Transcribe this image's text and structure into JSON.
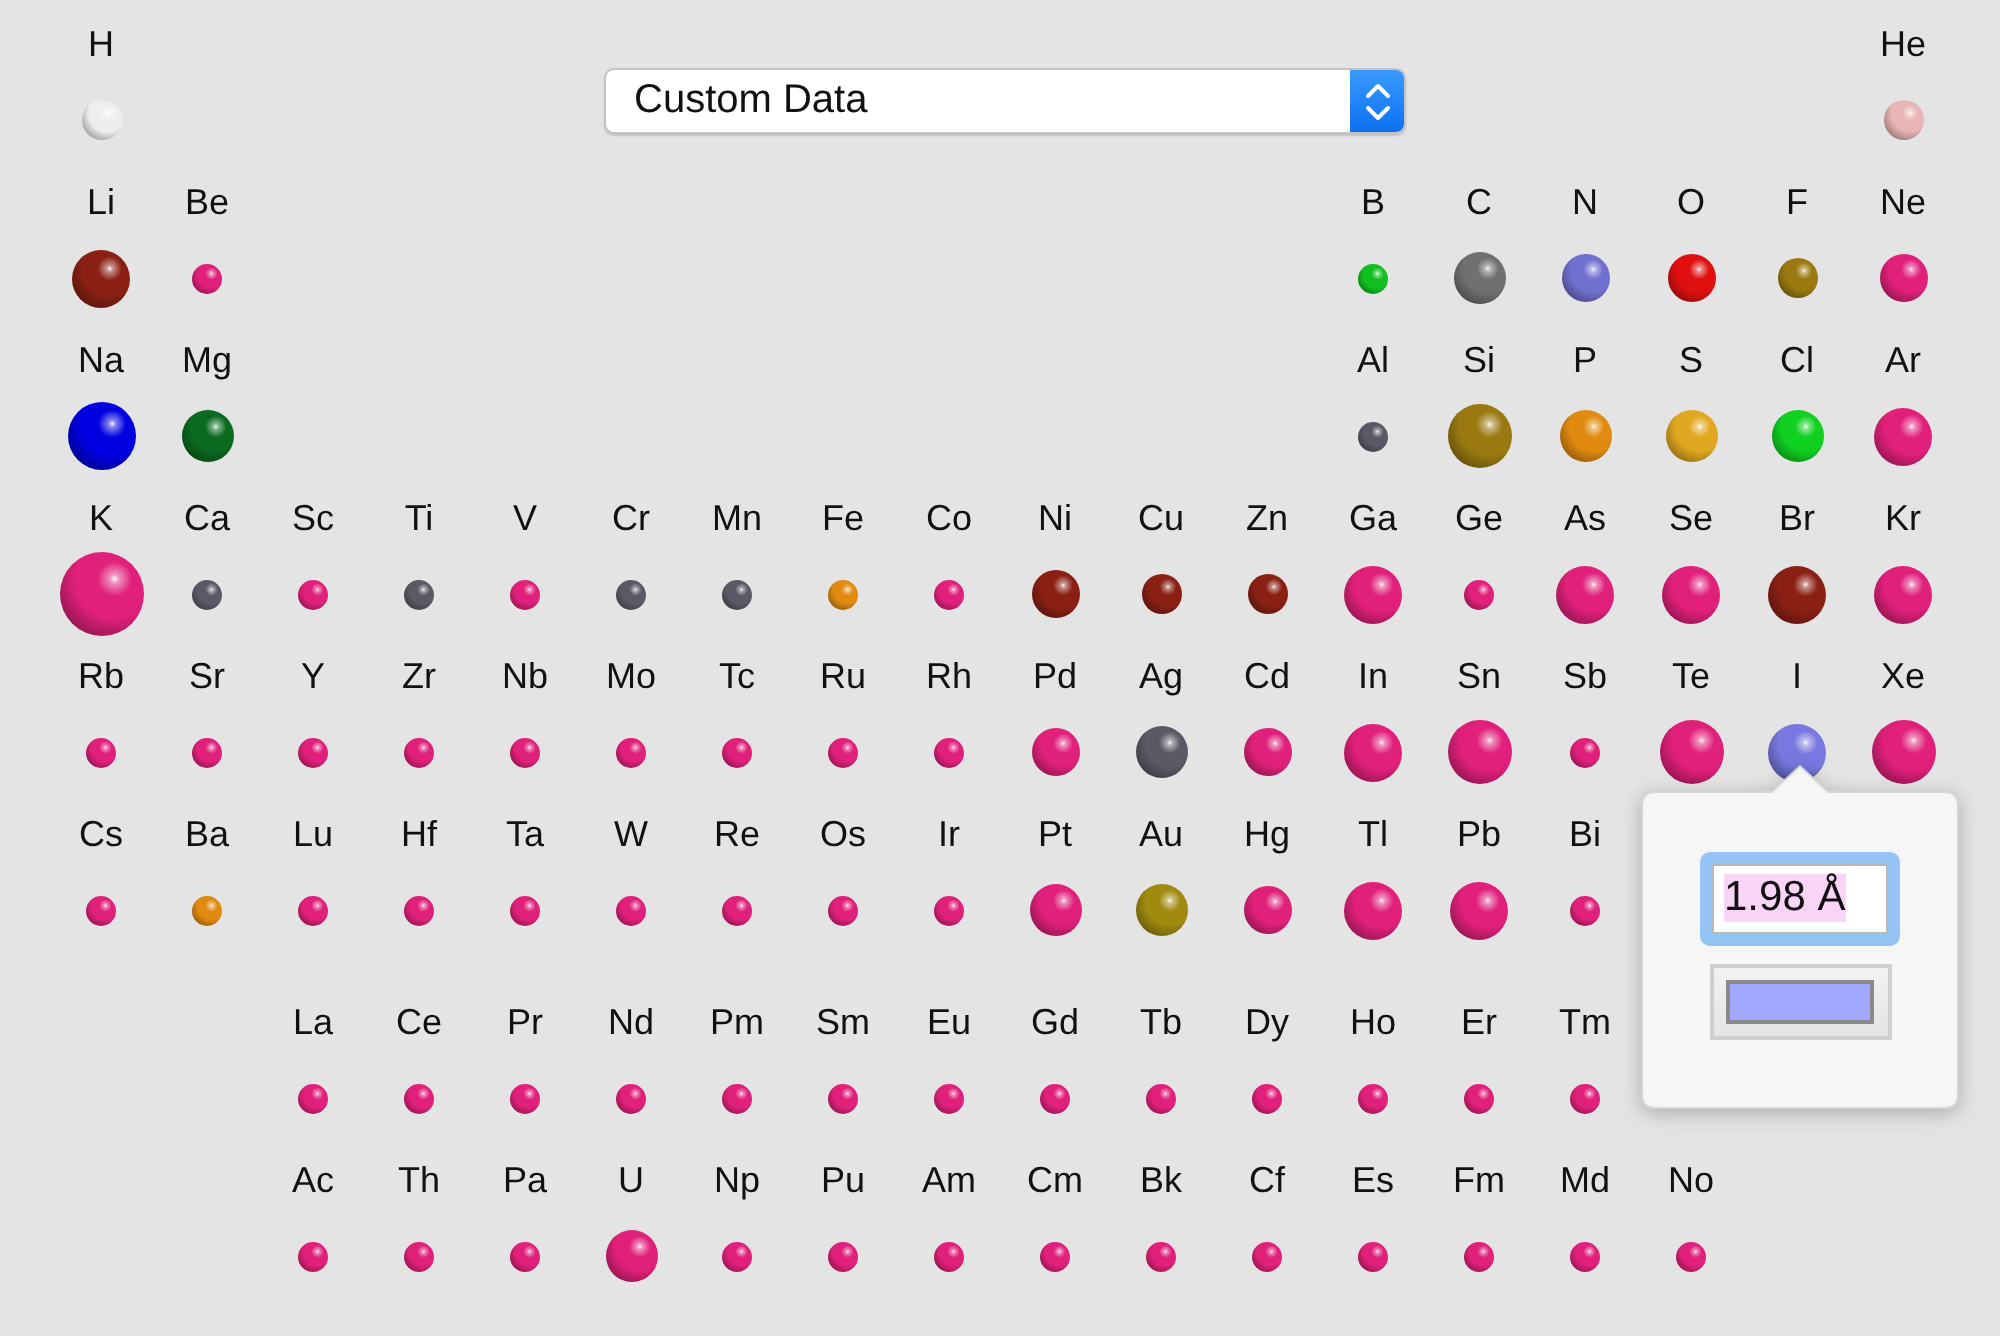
{
  "data_source_popup": {
    "value": "Custom Data"
  },
  "periods": [
    {
      "kind": "main",
      "left": [
        {
          "symbol": "H",
          "kind": "small",
          "color": "#eeeeee",
          "selected": false
        }
      ],
      "right": [
        {
          "symbol": "He",
          "kind": "small",
          "color": "#e8b4b4",
          "selected": false
        }
      ]
    },
    {
      "kind": "main",
      "left": [
        {
          "symbol": "Li",
          "kind": "larger",
          "color": "#8a2014",
          "selected": false
        },
        {
          "symbol": "Be",
          "kind": "tiny",
          "color": "#e0207a",
          "selected": false
        }
      ],
      "right": [
        {
          "symbol": "B",
          "kind": "tiny",
          "color": "#10c020",
          "selected": false
        },
        {
          "symbol": "C",
          "kind": "large",
          "color": "#707070",
          "selected": false
        },
        {
          "symbol": "N",
          "kind": "medium",
          "color": "#7070d0",
          "selected": false
        },
        {
          "symbol": "O",
          "kind": "medium",
          "color": "#e01010",
          "selected": false
        },
        {
          "symbol": "F",
          "kind": "small",
          "color": "#9a7a10",
          "selected": false
        },
        {
          "symbol": "Ne",
          "kind": "medium",
          "color": "#e0207a",
          "selected": false
        }
      ]
    },
    {
      "kind": "main",
      "left": [
        {
          "symbol": "Na",
          "kind": "bigger",
          "color": "#0000e0",
          "selected": false
        },
        {
          "symbol": "Mg",
          "kind": "large",
          "color": "#0a6a20",
          "selected": false
        }
      ],
      "right": [
        {
          "symbol": "Al",
          "kind": "tiny",
          "color": "#5a5a66",
          "selected": false
        },
        {
          "symbol": "Si",
          "kind": "big",
          "color": "#9a7a10",
          "selected": false
        },
        {
          "symbol": "P",
          "kind": "large",
          "color": "#e08a10",
          "selected": false
        },
        {
          "symbol": "S",
          "kind": "large",
          "color": "#e0a820",
          "selected": false
        },
        {
          "symbol": "Cl",
          "kind": "large",
          "color": "#10d020",
          "selected": false
        },
        {
          "symbol": "Ar",
          "kind": "larger",
          "color": "#e0207a",
          "selected": false
        }
      ]
    },
    {
      "kind": "main",
      "left": [
        {
          "symbol": "K",
          "kind": "huge",
          "color": "#e0207a",
          "selected": false
        },
        {
          "symbol": "Ca",
          "kind": "tiny",
          "color": "#5a5a66",
          "selected": false
        },
        {
          "symbol": "Sc",
          "kind": "tiny",
          "color": "#e0207a",
          "selected": false
        },
        {
          "symbol": "Ti",
          "kind": "tiny",
          "color": "#5a5a66",
          "selected": false
        },
        {
          "symbol": "V",
          "kind": "tiny",
          "color": "#e0207a",
          "selected": false
        },
        {
          "symbol": "Cr",
          "kind": "tiny",
          "color": "#5a5a66",
          "selected": false
        },
        {
          "symbol": "Mn",
          "kind": "tiny",
          "color": "#5a5a66",
          "selected": false
        },
        {
          "symbol": "Fe",
          "kind": "tiny",
          "color": "#e08a10",
          "selected": false
        },
        {
          "symbol": "Co",
          "kind": "tiny",
          "color": "#e0207a",
          "selected": false
        },
        {
          "symbol": "Ni",
          "kind": "medium",
          "color": "#8a2014",
          "selected": false
        },
        {
          "symbol": "Cu",
          "kind": "small",
          "color": "#8a2014",
          "selected": false
        },
        {
          "symbol": "Zn",
          "kind": "small",
          "color": "#8a2014",
          "selected": false
        },
        {
          "symbol": "Ga",
          "kind": "larger",
          "color": "#e0207a",
          "selected": false
        },
        {
          "symbol": "Ge",
          "kind": "tiny",
          "color": "#e0207a",
          "selected": false
        },
        {
          "symbol": "As",
          "kind": "larger",
          "color": "#e0207a",
          "selected": false
        },
        {
          "symbol": "Se",
          "kind": "larger",
          "color": "#e0207a",
          "selected": false
        },
        {
          "symbol": "Br",
          "kind": "larger",
          "color": "#8a2014",
          "selected": false
        },
        {
          "symbol": "Kr",
          "kind": "larger",
          "color": "#e0207a",
          "selected": false
        }
      ]
    },
    {
      "kind": "main",
      "left": [
        {
          "symbol": "Rb",
          "kind": "tiny",
          "color": "#e0207a",
          "selected": false
        },
        {
          "symbol": "Sr",
          "kind": "tiny",
          "color": "#e0207a",
          "selected": false
        },
        {
          "symbol": "Y",
          "kind": "tiny",
          "color": "#e0207a",
          "selected": false
        },
        {
          "symbol": "Zr",
          "kind": "tiny",
          "color": "#e0207a",
          "selected": false
        },
        {
          "symbol": "Nb",
          "kind": "tiny",
          "color": "#e0207a",
          "selected": false
        },
        {
          "symbol": "Mo",
          "kind": "tiny",
          "color": "#e0207a",
          "selected": false
        },
        {
          "symbol": "Tc",
          "kind": "tiny",
          "color": "#e0207a",
          "selected": false
        },
        {
          "symbol": "Ru",
          "kind": "tiny",
          "color": "#e0207a",
          "selected": false
        },
        {
          "symbol": "Rh",
          "kind": "tiny",
          "color": "#e0207a",
          "selected": false
        },
        {
          "symbol": "Pd",
          "kind": "medium",
          "color": "#e0207a",
          "selected": false
        },
        {
          "symbol": "Ag",
          "kind": "large",
          "color": "#5a5a66",
          "selected": false
        },
        {
          "symbol": "Cd",
          "kind": "medium",
          "color": "#e0207a",
          "selected": false
        },
        {
          "symbol": "In",
          "kind": "larger",
          "color": "#e0207a",
          "selected": false
        },
        {
          "symbol": "Sn",
          "kind": "big",
          "color": "#e0207a",
          "selected": false
        },
        {
          "symbol": "Sb",
          "kind": "tiny",
          "color": "#e0207a",
          "selected": false
        },
        {
          "symbol": "Te",
          "kind": "big",
          "color": "#e0207a",
          "selected": false
        },
        {
          "symbol": "I",
          "kind": "larger",
          "color": "#7878e0",
          "selected": true
        },
        {
          "symbol": "Xe",
          "kind": "big",
          "color": "#e0207a",
          "selected": false
        }
      ]
    },
    {
      "kind": "main",
      "left": [
        {
          "symbol": "Cs",
          "kind": "tiny",
          "color": "#e0207a",
          "selected": false
        },
        {
          "symbol": "Ba",
          "kind": "tiny",
          "color": "#e08a10",
          "selected": false
        },
        {
          "symbol": "Lu",
          "kind": "tiny",
          "color": "#e0207a",
          "selected": false
        },
        {
          "symbol": "Hf",
          "kind": "tiny",
          "color": "#e0207a",
          "selected": false
        },
        {
          "symbol": "Ta",
          "kind": "tiny",
          "color": "#e0207a",
          "selected": false
        },
        {
          "symbol": "W",
          "kind": "tiny",
          "color": "#e0207a",
          "selected": false
        },
        {
          "symbol": "Re",
          "kind": "tiny",
          "color": "#e0207a",
          "selected": false
        },
        {
          "symbol": "Os",
          "kind": "tiny",
          "color": "#e0207a",
          "selected": false
        },
        {
          "symbol": "Ir",
          "kind": "tiny",
          "color": "#e0207a",
          "selected": false
        },
        {
          "symbol": "Pt",
          "kind": "large",
          "color": "#e0207a",
          "selected": false
        },
        {
          "symbol": "Au",
          "kind": "large",
          "color": "#a08a10",
          "selected": false
        },
        {
          "symbol": "Hg",
          "kind": "medium",
          "color": "#e0207a",
          "selected": false
        },
        {
          "symbol": "Tl",
          "kind": "larger",
          "color": "#e0207a",
          "selected": false
        },
        {
          "symbol": "Pb",
          "kind": "larger",
          "color": "#e0207a",
          "selected": false
        },
        {
          "symbol": "Bi",
          "kind": "tiny",
          "color": "#e0207a",
          "selected": false
        }
      ]
    },
    {
      "kind": "f-block",
      "left": [
        {
          "symbol": "La",
          "kind": "tiny",
          "color": "#e0207a",
          "selected": false
        },
        {
          "symbol": "Ce",
          "kind": "tiny",
          "color": "#e0207a",
          "selected": false
        },
        {
          "symbol": "Pr",
          "kind": "tiny",
          "color": "#e0207a",
          "selected": false
        },
        {
          "symbol": "Nd",
          "kind": "tiny",
          "color": "#e0207a",
          "selected": false
        },
        {
          "symbol": "Pm",
          "kind": "tiny",
          "color": "#e0207a",
          "selected": false
        },
        {
          "symbol": "Sm",
          "kind": "tiny",
          "color": "#e0207a",
          "selected": false
        },
        {
          "symbol": "Eu",
          "kind": "tiny",
          "color": "#e0207a",
          "selected": false
        },
        {
          "symbol": "Gd",
          "kind": "tiny",
          "color": "#e0207a",
          "selected": false
        },
        {
          "symbol": "Tb",
          "kind": "tiny",
          "color": "#e0207a",
          "selected": false
        },
        {
          "symbol": "Dy",
          "kind": "tiny",
          "color": "#e0207a",
          "selected": false
        },
        {
          "symbol": "Ho",
          "kind": "tiny",
          "color": "#e0207a",
          "selected": false
        },
        {
          "symbol": "Er",
          "kind": "tiny",
          "color": "#e0207a",
          "selected": false
        },
        {
          "symbol": "Tm",
          "kind": "tiny",
          "color": "#e0207a",
          "selected": false
        }
      ]
    },
    {
      "kind": "f-block",
      "left": [
        {
          "symbol": "Ac",
          "kind": "tiny",
          "color": "#e0207a",
          "selected": false
        },
        {
          "symbol": "Th",
          "kind": "tiny",
          "color": "#e0207a",
          "selected": false
        },
        {
          "symbol": "Pa",
          "kind": "tiny",
          "color": "#e0207a",
          "selected": false
        },
        {
          "symbol": "U",
          "kind": "large",
          "color": "#e0207a",
          "selected": false
        },
        {
          "symbol": "Np",
          "kind": "tiny",
          "color": "#e0207a",
          "selected": false
        },
        {
          "symbol": "Pu",
          "kind": "tiny",
          "color": "#e0207a",
          "selected": false
        },
        {
          "symbol": "Am",
          "kind": "tiny",
          "color": "#e0207a",
          "selected": false
        },
        {
          "symbol": "Cm",
          "kind": "tiny",
          "color": "#e0207a",
          "selected": false
        },
        {
          "symbol": "Bk",
          "kind": "tiny",
          "color": "#e0207a",
          "selected": false
        },
        {
          "symbol": "Cf",
          "kind": "tiny",
          "color": "#e0207a",
          "selected": false
        },
        {
          "symbol": "Es",
          "kind": "tiny",
          "color": "#e0207a",
          "selected": false
        },
        {
          "symbol": "Fm",
          "kind": "tiny",
          "color": "#e0207a",
          "selected": false
        },
        {
          "symbol": "Md",
          "kind": "tiny",
          "color": "#e0207a",
          "selected": false
        },
        {
          "symbol": "No",
          "kind": "tiny",
          "color": "#e0207a",
          "selected": false
        }
      ]
    }
  ],
  "popover": {
    "radius_field": {
      "value": "1.98 Å"
    },
    "color_well": {
      "color": "#a0a8ff"
    }
  }
}
